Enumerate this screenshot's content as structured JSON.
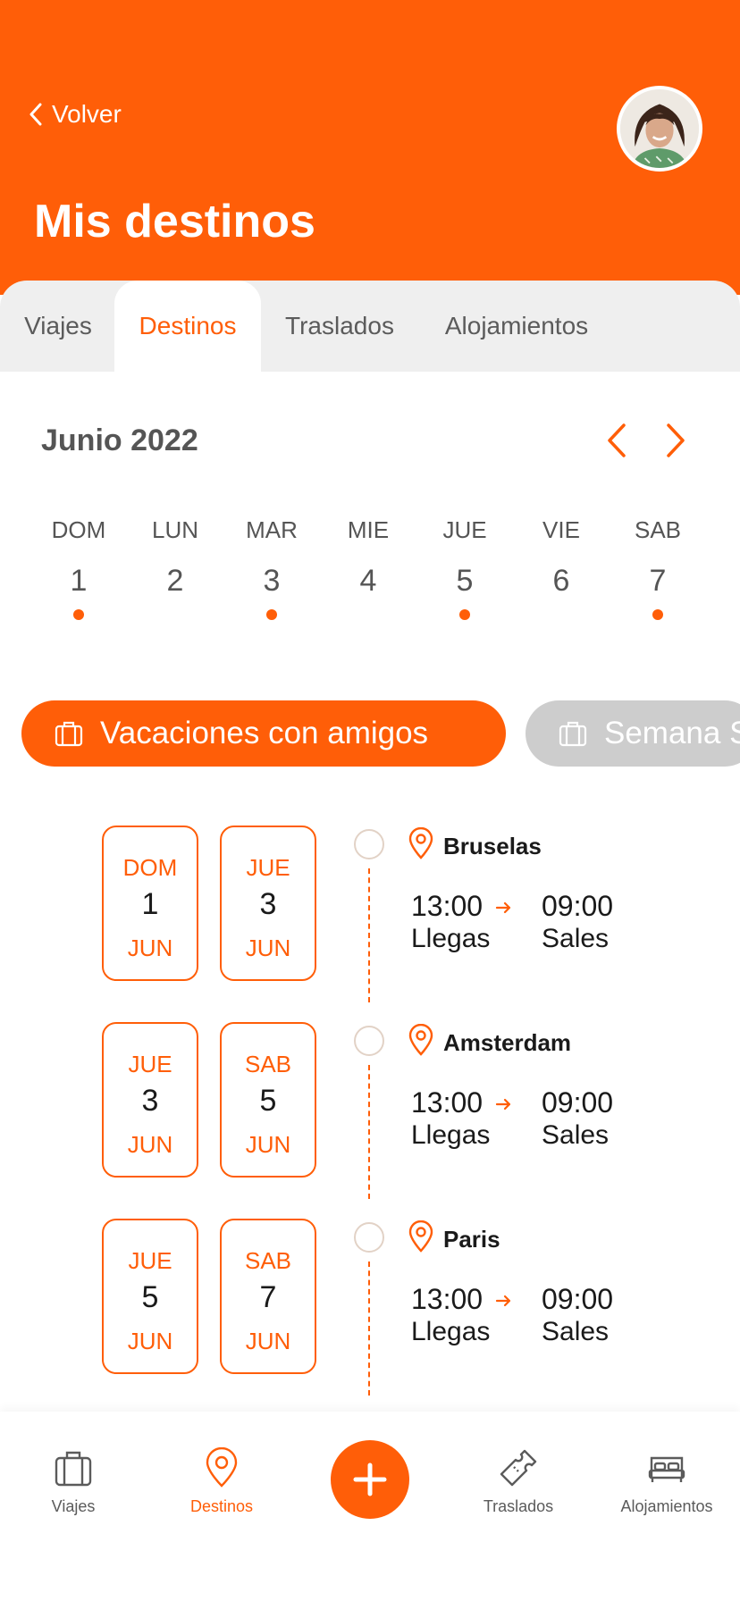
{
  "header": {
    "back_label": "Volver",
    "title": "Mis destinos"
  },
  "tabs": [
    {
      "label": "Viajes",
      "active": false
    },
    {
      "label": "Destinos",
      "active": true
    },
    {
      "label": "Traslados",
      "active": false
    },
    {
      "label": "Alojamientos",
      "active": false
    }
  ],
  "calendar": {
    "month_label": "Junio 2022",
    "prev_icon": "chevron-left-icon",
    "next_icon": "chevron-right-icon",
    "days": [
      {
        "name": "DOM",
        "num": "1",
        "has_event": true
      },
      {
        "name": "LUN",
        "num": "2",
        "has_event": false
      },
      {
        "name": "MAR",
        "num": "3",
        "has_event": true
      },
      {
        "name": "MIE",
        "num": "4",
        "has_event": false
      },
      {
        "name": "JUE",
        "num": "5",
        "has_event": true
      },
      {
        "name": "VIE",
        "num": "6",
        "has_event": false
      },
      {
        "name": "SAB",
        "num": "7",
        "has_event": true
      }
    ]
  },
  "trips": [
    {
      "label": "Vacaciones con amigos",
      "active": true,
      "icon": "suitcase-icon"
    },
    {
      "label": "Semana S",
      "active": false,
      "icon": "suitcase-icon"
    }
  ],
  "destinations": [
    {
      "from": {
        "weekday": "DOM",
        "day": "1",
        "month": "JUN"
      },
      "to": {
        "weekday": "JUE",
        "day": "3",
        "month": "JUN"
      },
      "city": "Bruselas",
      "arrival_time": "13:00",
      "arrival_label": "Llegas",
      "departure_time": "09:00",
      "departure_label": "Sales"
    },
    {
      "from": {
        "weekday": "JUE",
        "day": "3",
        "month": "JUN"
      },
      "to": {
        "weekday": "SAB",
        "day": "5",
        "month": "JUN"
      },
      "city": "Amsterdam",
      "arrival_time": "13:00",
      "arrival_label": "Llegas",
      "departure_time": "09:00",
      "departure_label": "Sales"
    },
    {
      "from": {
        "weekday": "JUE",
        "day": "5",
        "month": "JUN"
      },
      "to": {
        "weekday": "SAB",
        "day": "7",
        "month": "JUN"
      },
      "city": "Paris",
      "arrival_time": "13:00",
      "arrival_label": "Llegas",
      "departure_time": "09:00",
      "departure_label": "Sales"
    }
  ],
  "bottom_nav": [
    {
      "label": "Viajes",
      "icon": "suitcase-icon",
      "active": false
    },
    {
      "label": "Destinos",
      "icon": "location-pin-icon",
      "active": true
    },
    {
      "label": "Traslados",
      "icon": "ticket-icon",
      "active": false
    },
    {
      "label": "Alojamientos",
      "icon": "bed-icon",
      "active": false
    }
  ],
  "colors": {
    "accent": "#FF5E08",
    "inactive_chip": "#CDCDCD",
    "tab_bar": "#EFEFEF"
  }
}
